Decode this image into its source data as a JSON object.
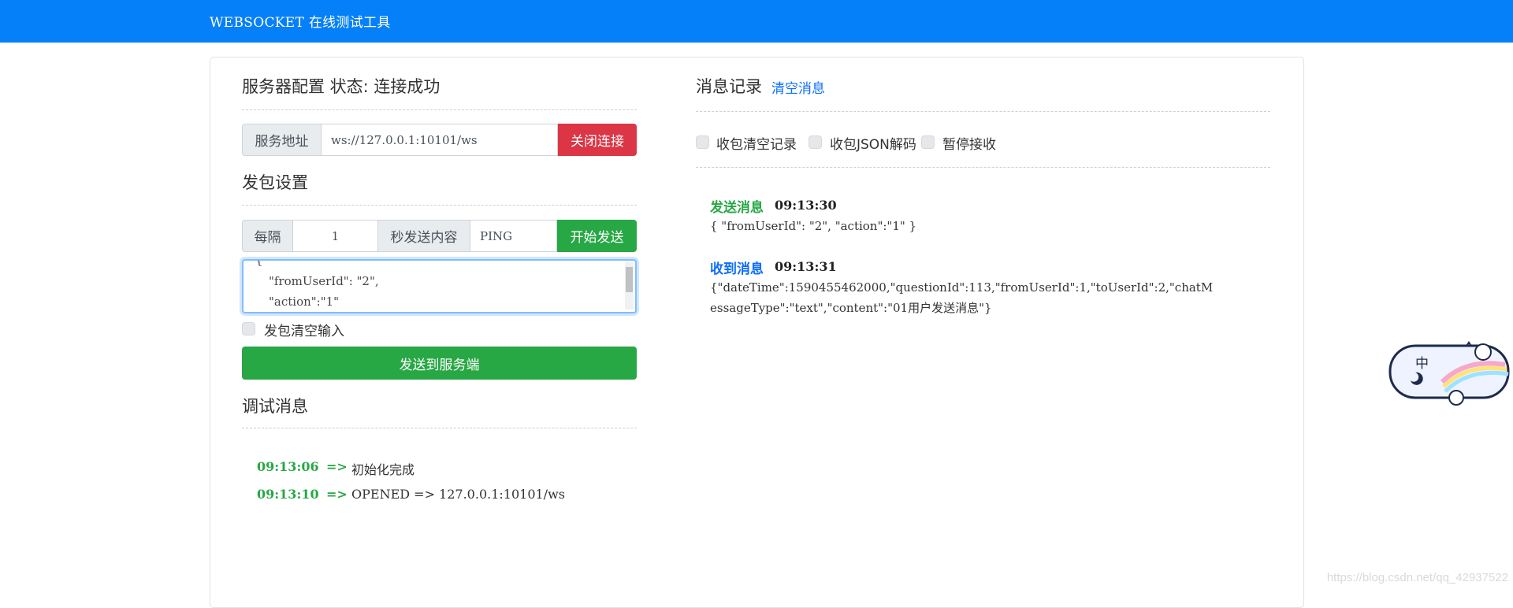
{
  "header": {
    "title": "WEBSOCKET 在线测试工具"
  },
  "server": {
    "title": "服务器配置 状态: 连接成功",
    "address_label": "服务地址",
    "address_value": "ws://127.0.0.1:10101/ws",
    "close_button": "关闭连接"
  },
  "send_settings": {
    "title": "发包设置",
    "every_label": "每隔",
    "interval_value": "1",
    "content_label": "秒发送内容",
    "content_value": "PING",
    "start_button": "开始发送",
    "textarea_lines": [
      "{",
      "\"fromUserId\": \"2\",",
      "\"action\":\"1\""
    ],
    "clear_input_label": "发包清空输入",
    "send_button": "发送到服务端"
  },
  "debug": {
    "title": "调试消息",
    "logs": [
      {
        "time": "09:13:06",
        "arrow": "=>",
        "text": "初始化完成"
      },
      {
        "time": "09:13:10",
        "arrow": "=>",
        "text": "OPENED => 127.0.0.1:10101/ws"
      }
    ]
  },
  "messages": {
    "title": "消息记录",
    "clear_link": "清空消息",
    "options": [
      "收包清空记录",
      "收包JSON解码",
      "暂停接收"
    ],
    "items": [
      {
        "label": "发送消息",
        "time": "09:13:30",
        "body": "{ \"fromUserId\": \"2\", \"action\":\"1\" }",
        "color": "#28a745"
      },
      {
        "label": "收到消息",
        "time": "09:13:31",
        "body_line1": "{\"dateTime\":1590455462000,\"questionId\":113,\"fromUserId\":1,\"toUserId\":2,\"chatM",
        "body_line2": "essageType\":\"text\",\"content\":\"01用户发送消息\"}",
        "color": "#0d6efd"
      }
    ]
  },
  "mascot": {
    "char": "中",
    "icon": "ime-mascot-icon"
  },
  "watermark": "https://blog.csdn.net/qq_42937522",
  "colors": {
    "primary": "#0680f8",
    "danger": "#dc3545",
    "success": "#28a745",
    "link": "#0d6efd"
  }
}
